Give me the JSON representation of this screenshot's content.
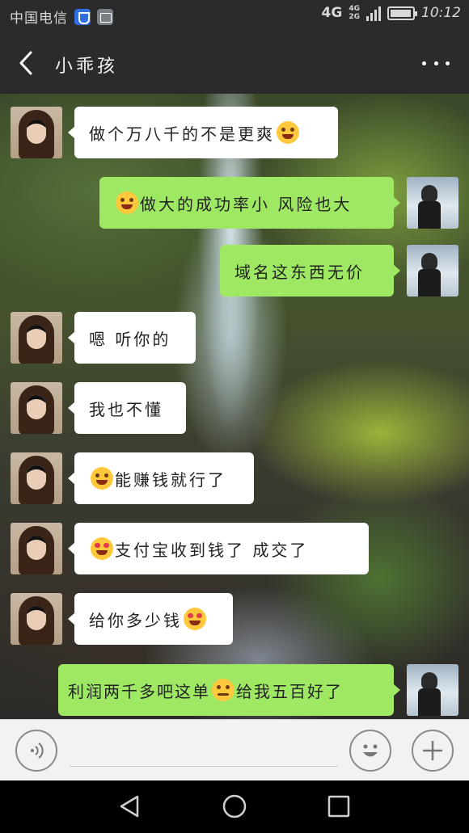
{
  "status_bar": {
    "carrier": "中国电信",
    "network_main": "4G",
    "network_top": "4G",
    "network_bottom": "2G",
    "time": "10:12",
    "icons": [
      "shield-icon",
      "gallery-icon",
      "signal-icon",
      "battery-icon"
    ]
  },
  "header": {
    "back_icon": "chevron-left-icon",
    "title": "小乖孩",
    "more_icon": "more-dots-icon"
  },
  "messages": [
    {
      "side": "in",
      "text": "做个万八千的不是更爽",
      "emoji_after": "grin-squint-icon"
    },
    {
      "side": "out",
      "emoji_before": "heart-eyes-blush-icon",
      "text": "做大的成功率小 风险也大"
    },
    {
      "side": "out",
      "text": "域名这东西无价"
    },
    {
      "side": "in",
      "text": "嗯 听你的"
    },
    {
      "side": "in",
      "text": "我也不懂"
    },
    {
      "side": "in",
      "emoji_before": "grin-squint-icon",
      "text": "能赚钱就行了"
    },
    {
      "side": "in",
      "emoji_before": "heart-eyes-icon",
      "text": "支付宝收到钱了 成交了"
    },
    {
      "side": "in",
      "text": "给你多少钱",
      "emoji_after": "heart-eyes-icon"
    },
    {
      "side": "out",
      "text_before": "利润两千多吧这单",
      "emoji_middle": "smirk-icon",
      "text_after": "给我五百好了"
    }
  ],
  "input_bar": {
    "voice_icon": "voice-icon",
    "input_value": "",
    "emoji_icon": "smiley-icon",
    "plus_icon": "plus-icon"
  },
  "nav_bar": {
    "icons": [
      "nav-back-icon",
      "nav-home-icon",
      "nav-recent-icon"
    ]
  },
  "colors": {
    "bar_bg": "#2b2b2b",
    "outgoing_bubble": "#9ee864",
    "incoming_bubble": "#ffffff",
    "input_bg": "#f2f2f2"
  }
}
